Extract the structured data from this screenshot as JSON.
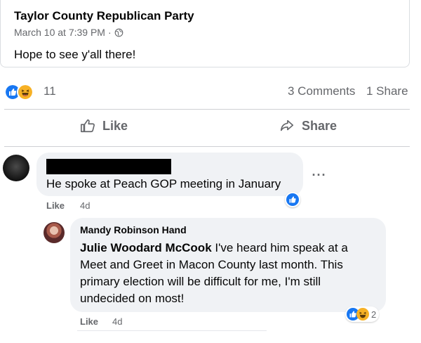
{
  "post": {
    "author": "Taylor County Republican Party",
    "timestamp": "March 10 at 7:39 PM",
    "separator": "·",
    "privacy_icon": "globe-icon",
    "text": "Hope to see y'all there!"
  },
  "engagement": {
    "reaction_icons": [
      "like-icon",
      "haha-icon"
    ],
    "reaction_count": "11",
    "comments": "3 Comments",
    "shares": "1 Share"
  },
  "actions": {
    "like_label": "Like",
    "share_label": "Share"
  },
  "comments": [
    {
      "author_redacted": true,
      "text": "He spoke at Peach GOP meeting in January",
      "like_label": "Like",
      "time": "4d",
      "more_label": "···",
      "reaction_icons": [
        "like-icon"
      ]
    }
  ],
  "reply": {
    "author": "Mandy Robinson Hand",
    "mention": "Julie Woodard McCook",
    "text": " I've heard him speak at a Meet and Greet in Macon County last month. This primary election will be difficult for me, I'm still undecided on most!",
    "reaction_icons": [
      "like-icon",
      "haha-icon"
    ],
    "reaction_count": "2",
    "like_label": "Like",
    "time": "4d"
  },
  "colors": {
    "facebook_blue": "#1877f2",
    "haha_yellow": "#f7b125",
    "secondary_text": "#65676b",
    "bubble_bg": "#f0f2f5"
  }
}
